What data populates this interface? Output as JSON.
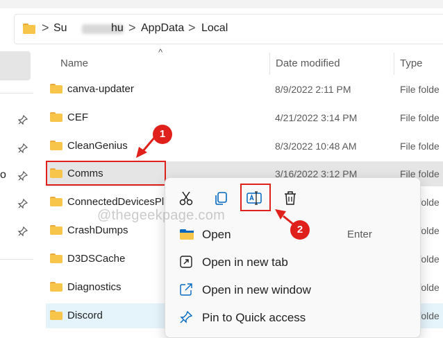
{
  "address": {
    "crumbs": [
      "Su",
      "hu",
      "AppData",
      "Local"
    ],
    "separators": [
      ">",
      ">",
      ">"
    ]
  },
  "columns": {
    "name": "Name",
    "date": "Date modified",
    "type": "Type"
  },
  "rows": [
    {
      "name": "canva-updater",
      "date": "8/9/2022 2:11 PM",
      "type": "File folde"
    },
    {
      "name": "CEF",
      "date": "4/21/2022 3:14 PM",
      "type": "File folde"
    },
    {
      "name": "CleanGenius",
      "date": "8/3/2022 10:48 AM",
      "type": "File folde"
    },
    {
      "name": "Comms",
      "date": "3/16/2022 3:12 PM",
      "type": "File folde"
    },
    {
      "name": "ConnectedDevicesPla",
      "date": "",
      "type": "File folde"
    },
    {
      "name": "CrashDumps",
      "date": "",
      "type": "File folde"
    },
    {
      "name": "D3DSCache",
      "date": "",
      "type": "File folde"
    },
    {
      "name": "Diagnostics",
      "date": "",
      "type": "File folde"
    },
    {
      "name": "Discord",
      "date": "",
      "type": "File folde"
    }
  ],
  "left_pane": {
    "partial_text": "o"
  },
  "context_menu": {
    "toolbar": [
      "cut-icon",
      "copy-icon",
      "rename-icon",
      "delete-icon"
    ],
    "items": [
      {
        "label": "Open",
        "shortcut": "Enter",
        "icon": "open-folder-icon"
      },
      {
        "label": "Open in new tab",
        "shortcut": "",
        "icon": "new-tab-icon"
      },
      {
        "label": "Open in new window",
        "shortcut": "",
        "icon": "new-window-icon"
      },
      {
        "label": "Pin to Quick access",
        "shortcut": "",
        "icon": "pin-icon"
      }
    ]
  },
  "annotations": {
    "badge1": "1",
    "badge2": "2",
    "color": "#e0201b"
  },
  "watermark": "@thegeekpage.com",
  "colors": {
    "folder": "#f6c549",
    "selected_row": "#e5e5e5",
    "hover_row": "#e5f3fb",
    "accent": "#0067c0"
  }
}
